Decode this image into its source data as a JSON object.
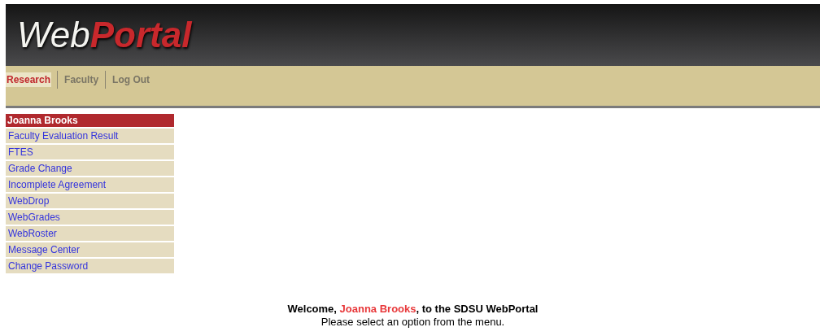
{
  "logo": "Web**Portal**",
  "nav": [
    {
      "label": "Research",
      "selected": true
    },
    {
      "label": "Faculty",
      "selected": false
    },
    {
      "label": "Log Out",
      "selected": false
    }
  ],
  "sidebar": {
    "title": "Joanna Brooks",
    "items": [
      "Faculty Evaluation Result",
      "FTES",
      "Grade Change",
      "Incomplete Agreement",
      "WebDrop",
      "WebGrades",
      "WebRoster",
      "Message Center",
      "Change Password"
    ]
  },
  "welcome": {
    "before": "Welcome,",
    "name": "Joanna Brooks",
    "after": ", to the SDSU WebPortal",
    "subtitle": "Please select an option from the menu."
  }
}
